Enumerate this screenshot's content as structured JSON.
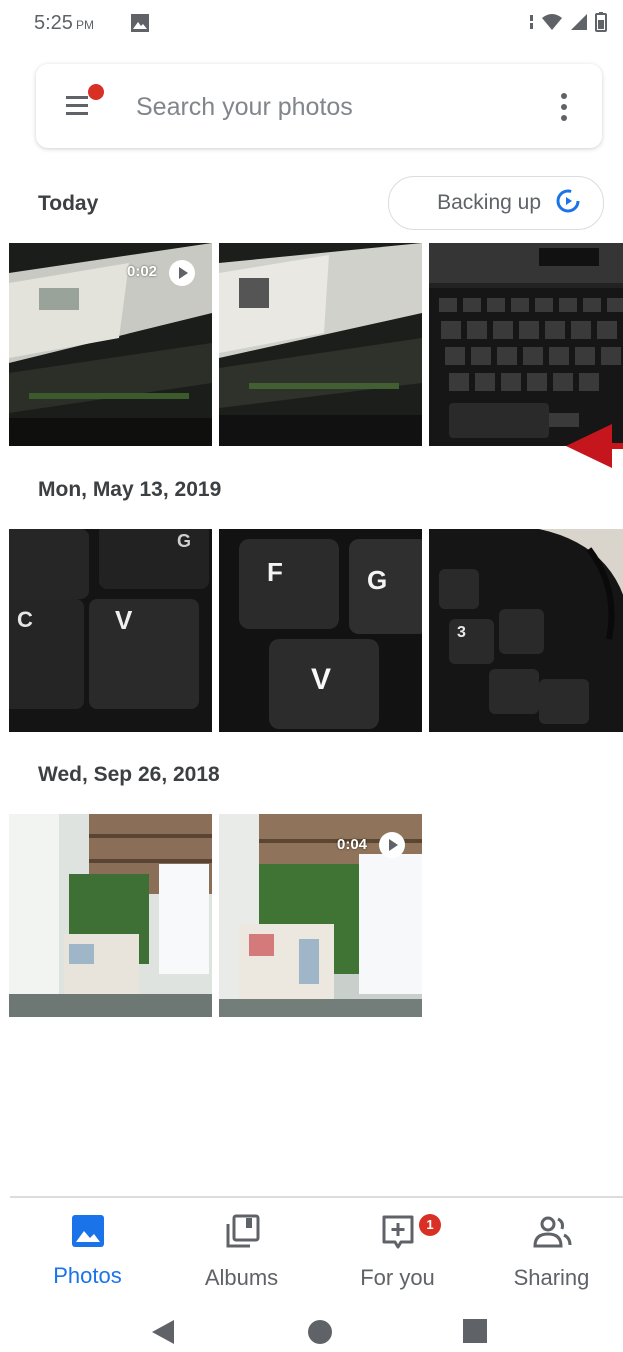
{
  "status_bar": {
    "time": "5:25",
    "ampm": "PM",
    "icons": [
      "image-icon",
      "data-transfer-icon",
      "wifi-icon",
      "signal-icon",
      "battery-icon"
    ]
  },
  "search": {
    "placeholder": "Search your photos",
    "menu_icon": "menu-icon",
    "overflow_icon": "more-vert-icon"
  },
  "sections": [
    {
      "title": "Today",
      "items": [
        {
          "kind": "video",
          "duration": "0:02",
          "subject": "laptop-screen"
        },
        {
          "kind": "photo",
          "subject": "laptop-screen"
        },
        {
          "kind": "photo",
          "subject": "keyboard"
        }
      ]
    },
    {
      "title": "Mon, May 13, 2019",
      "items": [
        {
          "kind": "photo",
          "subject": "keyboard-keys-cv"
        },
        {
          "kind": "photo",
          "subject": "keyboard-keys-fgv"
        },
        {
          "kind": "photo",
          "subject": "numpad"
        }
      ]
    },
    {
      "title": "Wed, Sep 26, 2018",
      "items": [
        {
          "kind": "photo",
          "subject": "office-plant"
        },
        {
          "kind": "video",
          "duration": "0:04",
          "subject": "office-plant"
        }
      ]
    }
  ],
  "backup_chip": {
    "label": "Backing up",
    "icon": "sync-icon",
    "accent": "#1a73e8"
  },
  "bottom_nav": [
    {
      "label": "Photos",
      "icon": "photos-icon",
      "active": true
    },
    {
      "label": "Albums",
      "icon": "albums-icon",
      "active": false
    },
    {
      "label": "For you",
      "icon": "for-you-icon",
      "active": false,
      "badge": "1"
    },
    {
      "label": "Sharing",
      "icon": "sharing-icon",
      "active": false
    }
  ],
  "system_nav": [
    "back-icon",
    "home-icon",
    "recents-icon"
  ],
  "colors": {
    "accent": "#1a73e8",
    "badge": "#d93025",
    "annotation_arrow": "#c5161d"
  }
}
